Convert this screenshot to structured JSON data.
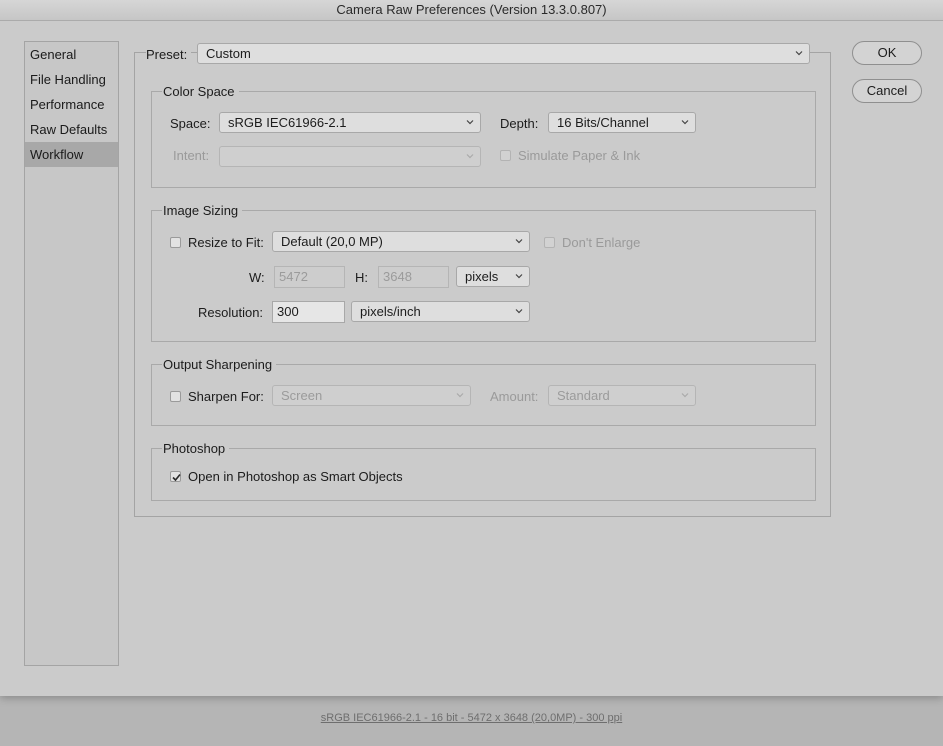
{
  "window": {
    "title": "Camera Raw Preferences  (Version 13.3.0.807)"
  },
  "sidebar": {
    "items": [
      {
        "label": "General"
      },
      {
        "label": "File Handling"
      },
      {
        "label": "Performance"
      },
      {
        "label": "Raw Defaults"
      },
      {
        "label": "Workflow",
        "selected": true
      }
    ]
  },
  "preset": {
    "label": "Preset:",
    "value": "Custom"
  },
  "color_space": {
    "title": "Color Space",
    "space_label": "Space:",
    "space_value": "sRGB IEC61966-2.1",
    "depth_label": "Depth:",
    "depth_value": "16 Bits/Channel",
    "intent_label": "Intent:",
    "intent_value": "",
    "simulate_label": "Simulate Paper & Ink",
    "simulate_checked": false
  },
  "image_sizing": {
    "title": "Image Sizing",
    "resize_label": "Resize to Fit:",
    "resize_checked": false,
    "resize_value": "Default  (20,0 MP)",
    "dont_enlarge_label": "Don't Enlarge",
    "w_label": "W:",
    "w_value": "5472",
    "h_label": "H:",
    "h_value": "3648",
    "size_unit": "pixels",
    "resolution_label": "Resolution:",
    "resolution_value": "300",
    "resolution_unit": "pixels/inch"
  },
  "output_sharpening": {
    "title": "Output Sharpening",
    "sharpen_label": "Sharpen For:",
    "sharpen_checked": false,
    "sharpen_value": "Screen",
    "amount_label": "Amount:",
    "amount_value": "Standard"
  },
  "photoshop": {
    "title": "Photoshop",
    "smart_objects_label": "Open in Photoshop as Smart Objects",
    "smart_objects_checked": true
  },
  "buttons": {
    "ok": "OK",
    "cancel": "Cancel"
  },
  "status_link": "sRGB IEC61966-2.1 - 16 bit - 5472 x 3648 (20,0MP) - 300 ppi"
}
